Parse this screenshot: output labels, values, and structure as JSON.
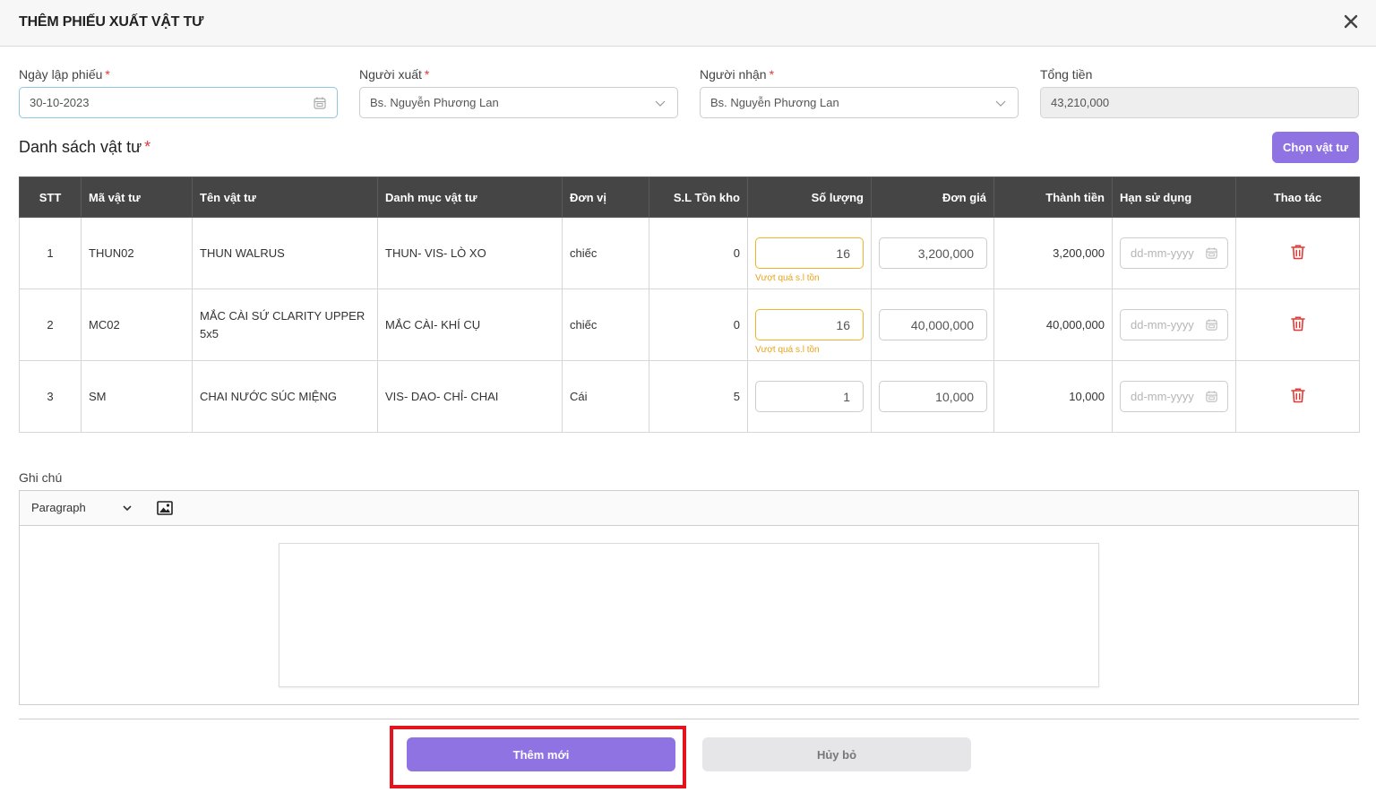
{
  "modal": {
    "title": "THÊM PHIẾU XUẤT VẬT TƯ"
  },
  "form": {
    "date": {
      "label": "Ngày lập phiếu",
      "value": "30-10-2023"
    },
    "exporter": {
      "label": "Người xuất",
      "value": "Bs. Nguyễn Phương Lan"
    },
    "receiver": {
      "label": "Người nhận",
      "value": "Bs. Nguyễn Phương Lan"
    },
    "total": {
      "label": "Tổng tiền",
      "value": "43,210,000"
    },
    "required_mark": "*"
  },
  "items_section": {
    "title": "Danh sách vật tư",
    "choose_button": "Chọn vật tư"
  },
  "table": {
    "headers": [
      "STT",
      "Mã vật tư",
      "Tên vật tư",
      "Danh mục vật tư",
      "Đơn vị",
      "S.L Tồn kho",
      "Số lượng",
      "Đơn giá",
      "Thành tiền",
      "Hạn sử dụng",
      "Thao tác"
    ],
    "date_placeholder": "dd-mm-yyyy",
    "warning": "Vượt quá s.l tồn",
    "rows": [
      {
        "stt": "1",
        "code": "THUN02",
        "name": "THUN WALRUS",
        "category": "THUN- VIS- LÒ XO",
        "unit": "chiếc",
        "stock": "0",
        "qty": "16",
        "price": "3,200,000",
        "amount": "3,200,000"
      },
      {
        "stt": "2",
        "code": "MC02",
        "name": "MẮC CÀI SỨ CLARITY UPPER 5x5",
        "category": "MẮC CÀI- KHÍ CỤ",
        "unit": "chiếc",
        "stock": "0",
        "qty": "16",
        "price": "40,000,000",
        "amount": "40,000,000"
      },
      {
        "stt": "3",
        "code": "SM",
        "name": "CHAI NƯỚC SÚC MIỆNG",
        "category": "VIS- DAO- CHỈ- CHAI",
        "unit": "Cái",
        "stock": "5",
        "qty": "1",
        "price": "10,000",
        "amount": "10,000"
      }
    ]
  },
  "note": {
    "label": "Ghi chú",
    "format": "Paragraph"
  },
  "footer": {
    "add_button": "Thêm mới",
    "cancel_button": "Hủy bỏ"
  },
  "colors": {
    "accent": "#8f73e3",
    "header_bg": "#454545",
    "warning": "#e8a317",
    "danger": "#e53935",
    "highlight": "#e3141e"
  },
  "icons": {
    "close": "close-icon",
    "calendar": "calendar-icon",
    "dropdown": "chevron-down-icon",
    "delete": "trash-icon",
    "image": "image-icon"
  }
}
